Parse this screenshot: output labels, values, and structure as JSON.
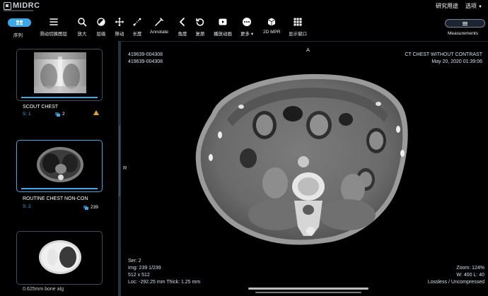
{
  "app": {
    "logo_text": "MIDRC",
    "top_links": {
      "research": "研究用途",
      "options": "选项"
    }
  },
  "toolbar": {
    "series_label": "序列",
    "tools": [
      {
        "id": "scroll",
        "label": "滑动切换图层",
        "icon": "layers-scroll-icon"
      },
      {
        "id": "zoom",
        "label": "放大",
        "icon": "magnifier-icon"
      },
      {
        "id": "level",
        "label": "层级",
        "icon": "contrast-icon"
      },
      {
        "id": "pan",
        "label": "移动",
        "icon": "move-arrows-icon"
      },
      {
        "id": "length",
        "label": "长度",
        "icon": "ruler-icon"
      },
      {
        "id": "annotate",
        "label": "Annotate",
        "icon": "annotate-icon"
      },
      {
        "id": "angle",
        "label": "角度",
        "icon": "angle-icon"
      },
      {
        "id": "reset",
        "label": "复原",
        "icon": "reset-icon"
      },
      {
        "id": "cine",
        "label": "播放动画",
        "icon": "play-icon"
      },
      {
        "id": "more",
        "label": "更多",
        "icon": "more-icon"
      },
      {
        "id": "mpr",
        "label": "2D MPR",
        "icon": "cube-icon"
      },
      {
        "id": "layout",
        "label": "显示窗口",
        "icon": "grid-layout-icon"
      }
    ],
    "measurements_label": "Measurements"
  },
  "series": [
    {
      "title": "SCOUT CHEST",
      "series_no": "S: 1",
      "count": "2",
      "warning": true
    },
    {
      "title": "ROUTINE CHEST NON-CON",
      "series_no": "S: 2",
      "count": "239",
      "warning": false
    },
    {
      "title": "0.625mm bone alg",
      "series_no": "",
      "count": "",
      "warning": false
    }
  ],
  "viewport": {
    "top_left": [
      "419639-004308",
      "419639-004308"
    ],
    "top_right": [
      "CT CHEST WITHOUT CONTRAST",
      "May 20, 2020 01:39:06"
    ],
    "bottom_left": [
      "Ser: 2",
      "Img: 239 1/239",
      "512 x 512",
      "Loc: -292.25 mm Thick: 1.25 mm"
    ],
    "bottom_right": [
      "Zoom: 124%",
      "W: 400 L: 40",
      "Lossless / Uncompressed"
    ],
    "orientation": {
      "top": "A",
      "left": "R"
    }
  },
  "colors": {
    "accent": "#3ea7e6",
    "warning": "#e8a326"
  }
}
